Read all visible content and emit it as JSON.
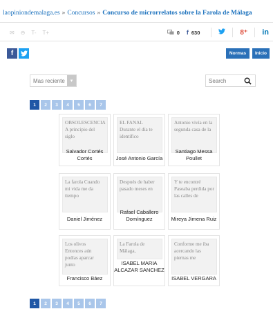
{
  "breadcrumb": {
    "items": [
      "laopiniondemalaga.es",
      "Concursos",
      "Concurso de microrrelatos sobre la Farola de Málaga"
    ],
    "separator": "»"
  },
  "tools": {
    "left_icons": [
      "✉",
      "⊖",
      "T-",
      "T+"
    ],
    "comments_count": "0",
    "facebook_count": "630",
    "facebook_label": "f",
    "twitter_label": "🐦",
    "gplus_label": "8⁺",
    "linkedin_label": "in"
  },
  "share": {
    "facebook": "f",
    "twitter": "🐦"
  },
  "nav": {
    "normas": "Normas",
    "inicio": "Inicio"
  },
  "filters": {
    "sort_selected": "Mas reciente",
    "search_placeholder": "Search"
  },
  "pagination": {
    "pages": [
      "1",
      "2",
      "3",
      "4",
      "5",
      "6",
      "7"
    ],
    "active": "1"
  },
  "entries": [
    {
      "excerpt": "OBSOLESCENCIA A principio del siglo",
      "author": "Salvador Cortés Cortés"
    },
    {
      "excerpt": "EL FANAL Durante el día te identifico",
      "author": "José Antonio García"
    },
    {
      "excerpt": "Antonio vivía en la segunda casa de la",
      "author": "Santiago Messa Poullet"
    },
    {
      "excerpt": "La farola Cuando mi vida me da tiempo",
      "author": "Daniel Jiménez"
    },
    {
      "excerpt": "Después de haber pasado meses en",
      "author": "Rafael Caballero Domínguez"
    },
    {
      "excerpt": "Y te encontré Paseaba perdida por las calles de",
      "author": "Mireya Jimena Ruiz"
    },
    {
      "excerpt": "Los olivos Entonces aún podías aparcar junto",
      "author": "Francisco Báez"
    },
    {
      "excerpt": "La Farola de Málaga,",
      "author": "ISABEL MARIA ALCAZAR SANCHEZ"
    },
    {
      "excerpt": "Conforme me iba acercando las piernas me",
      "author": "ISABEL VERGARA"
    }
  ],
  "colors": {
    "link": "#1e73be",
    "page_active": "#1f57a6",
    "page_inactive": "#a9c6ea",
    "facebook": "#3b5998",
    "twitter": "#1da1f2",
    "nav_button": "#2a70b8"
  }
}
